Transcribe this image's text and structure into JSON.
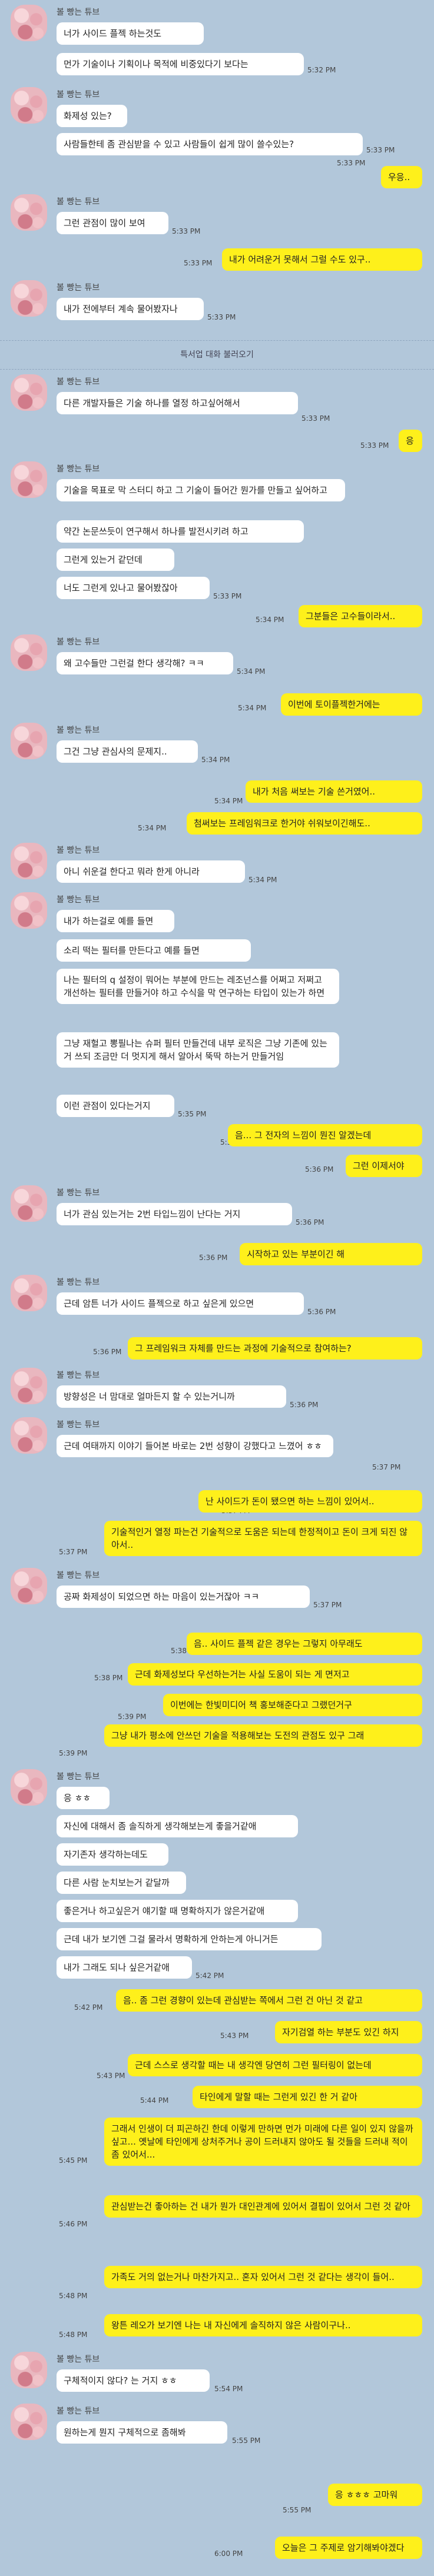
{
  "sender_name": "볼 빵는 튜브",
  "divider_text": "특서업 대화 불러오기",
  "messages": [
    {
      "text": "너가 사이드 플젝 하는것도"
    },
    {
      "text": "먼가 기술이나 기획이나 목적에 비중있다기 보다는",
      "time": "5:32 PM"
    },
    {
      "text": "화제성 있는?"
    },
    {
      "text": "사람들한테 좀 관심받을 수 있고 사람들이 쉽게 많이 쓸수있는?",
      "time": "5:33 PM"
    },
    {
      "text": "우응..",
      "time": "5:33 PM"
    },
    {
      "text": "그런 관점이 많이 보여",
      "time": "5:33 PM"
    },
    {
      "text": "내가 어려운거 못해서 그럴 수도 있구..",
      "time": "5:33 PM"
    },
    {
      "text": "내가 전에부터 계속 물어봤자나",
      "time": "5:33 PM"
    },
    {
      "text": "다른 개발자들은 기술 하나를 열정 하고싶어해서",
      "time": "5:33 PM"
    },
    {
      "text": "응",
      "time": "5:33 PM"
    },
    {
      "text": "기술을 목표로 막 스터디 하고 그 기술이 들어간 뭔가를 만들고 싶어하고"
    },
    {
      "text": "약간 논문쓰듯이 연구해서 하나를 발전시키려 하고"
    },
    {
      "text": "그런게 있는거 같던데"
    },
    {
      "text": "너도 그런게 있나고 물어봤잖아",
      "time": "5:33 PM"
    },
    {
      "text": "그분들은 고수들이라서..",
      "time": "5:34 PM"
    },
    {
      "text": "왜 고수들만 그런걸 한다 생각해? ㅋㅋ",
      "time": "5:34 PM"
    },
    {
      "text": "이번에 토이플젝한거에는",
      "time": "5:34 PM"
    },
    {
      "text": "그건 그냥 관심사의 문제지..",
      "time": "5:34 PM"
    },
    {
      "text": "내가 처음 써보는 기술 쓴거였어..",
      "time": "5:34 PM"
    },
    {
      "text": "첨써보는 프레임워크로 한거야 쉬워보이긴해도..",
      "time": "5:34 PM"
    },
    {
      "text": "아니 쉬운걸 한다고 뭐라 한게 아니라",
      "time": "5:34 PM"
    },
    {
      "text": "내가 하는걸로 예를 들면"
    },
    {
      "text": "소리 떡는 필터를 만든다고 예를 들면"
    },
    {
      "text": "나는 필터의 q 설정이 뭐어는 부분에 만드는 레조넌스를 어쩌고 저쩌고 개선하는 필터를 만들거야 하고 수식을 막 연구하는 타입이 있는가 하면"
    },
    {
      "text": "그냥 재헐고 뽕필나는 슈퍼 필터 만들건데 내부 로직은 그냥 기존에 있는거 쓰되 조금만 더 멋지게 해서 알아서 뚝딱 하는거 만들거임"
    },
    {
      "text": "이런 관점이 있다는거지",
      "time": "5:35 PM"
    },
    {
      "text": "음... 그 전자의 느낌이 뭔진 알겠는데",
      "time": "5:35 PM"
    },
    {
      "text": "그런 이제서야",
      "time": "5:36 PM"
    },
    {
      "text": "너가 관심 있는거는 2번 타입느낌이 난다는 거지",
      "time": "5:36 PM"
    },
    {
      "text": "시작하고 있는 부분이긴 해",
      "time": "5:36 PM"
    },
    {
      "text": "근데 암튼 너가 사이드 플젝으로 하고 싶은게 있으면",
      "time": "5:36 PM"
    },
    {
      "text": "그 프레임워크 자체를 만드는 과정에 기술적으로 참여하는?",
      "time": "5:36 PM"
    },
    {
      "text": "방향성은 너 맘대로 얼마든지 할 수 있는거니까",
      "time": "5:36 PM"
    },
    {
      "text": "근데 여태까지 이야기 들어본 바로는 2번 성향이 강했다고 느꼈어 ㅎㅎ",
      "time": "5:37 PM"
    },
    {
      "text": "난 사이드가 돈이 됐으면 하는 느낌이 있어서..",
      "time": "5:37 PM"
    },
    {
      "text": "기술적인거 열정 파는건 기술적으로 도움은 되는데 한정적이고 돈이 크게 되진 않아서..",
      "time": "5:37 PM"
    },
    {
      "text": "공짜 화제성이 되었으면 하는 마음이 있는거잖아 ㅋㅋ",
      "time": "5:37 PM"
    },
    {
      "text": "음.. 사이드 플젝 같은 경우는 그렇지 아무래도",
      "time": "5:38 PM"
    },
    {
      "text": "근데 화제성보다 우선하는거는 사실 도움이 되는 게 면저고",
      "time": "5:38 PM"
    },
    {
      "text": "이번에는 한빛미디어 책 홍보해준다고 그랬던거구",
      "time": "5:39 PM"
    },
    {
      "text": "그냥 내가 평소에 안쓰던 기술을 적용해보는 도전의 관점도 있구 그래",
      "time": "5:39 PM"
    },
    {
      "text": "응 ㅎㅎ"
    },
    {
      "text": "자신에 대해서 좀 솔직하게 생각해보는게 좋을거같애"
    },
    {
      "text": "자기존자 생각하는데도"
    },
    {
      "text": "다른 사람 눈치보는거 같달까"
    },
    {
      "text": "좋은거나 하고싶은거 얘기할 때 명확하지가 않은거같애"
    },
    {
      "text": "근데 내가 보기엔 그걸 물라서 명확하게 안하는게 아니거든"
    },
    {
      "text": "내가 그래도 되나 싶은거같애",
      "time": "5:42 PM"
    },
    {
      "text": "음.. 좀 그런 경향이 있는데 관심받는 쪽에서 그런 건 아닌 것 같고",
      "time": "5:42 PM"
    },
    {
      "text": "자기검열 하는 부분도 있긴 하지",
      "time": "5:43 PM"
    },
    {
      "text": "근데 스스로 생각할 때는 내 생각엔 당연히 그런 필터링이 없는데",
      "time": "5:43 PM"
    },
    {
      "text": "타인에게 말할 때는 그런게 있긴 한 거 같아",
      "time": "5:44 PM"
    },
    {
      "text": "그래서 인생이 더 피곤하긴 한데 이렇게 만하면 먼가 미래에 다른 일이 있지 않을까 싶고... 옛날에 타인에게 상처주거나 공이 드러내지 않아도 될 것들을 드러내 적이 좀 있어서...",
      "time": "5:45 PM"
    },
    {
      "text": "관심받는건 좋아하는 건 내가 뭔가 대인관계에 있어서 결핍이 있어서 그런 것 같아",
      "time": "5:46 PM"
    },
    {
      "text": "가족도 거의 없는거나 마찬가지고.. 혼자 있어서 그런 것 같다는 생각이 들어..",
      "time": "5:48 PM"
    },
    {
      "text": "왕튼 레오가 보기엔 나는 내 자신에게 솔직하지 않은 사람이구나..",
      "time": "5:48 PM"
    },
    {
      "text": "구체적이지 않다? 는 거지 ㅎㅎ",
      "time": "5:54 PM"
    },
    {
      "text": "원하는게 뭔지 구체적으로 좀해봐",
      "time": "5:55 PM"
    },
    {
      "text": "응 ㅎㅎㅎ 고마워",
      "time": "5:55 PM"
    },
    {
      "text": "오늘은 그 주제로 암기해봐야겠다",
      "time": "6:00 PM"
    }
  ]
}
